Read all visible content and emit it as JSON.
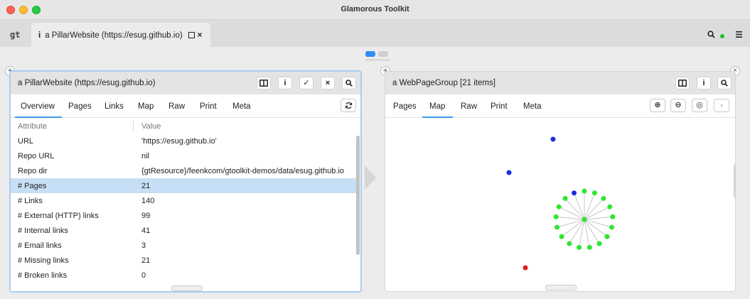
{
  "window": {
    "title": "Glamorous Toolkit"
  },
  "tabstrip": {
    "home_label": "gt",
    "tab_icon": "i",
    "tab_label": "a PillarWebsite (https://esug.github.io)",
    "close": "×",
    "search_icon": "search-icon",
    "menu_icon": "menu-icon"
  },
  "left_pane": {
    "title": "a PillarWebsite (https://esug.github.io)",
    "header_buttons": [
      "book-icon",
      "info-icon",
      "check-icon",
      "close-icon",
      "search-icon"
    ],
    "tabs": [
      "Overview",
      "Pages",
      "Links",
      "Map",
      "Raw",
      "Print",
      "Meta"
    ],
    "active_tab": "Overview",
    "columns": [
      "Attribute",
      "Value"
    ],
    "rows": [
      {
        "attribute": "URL",
        "value": "'https://esug.github.io'"
      },
      {
        "attribute": "Repo URL",
        "value": "nil"
      },
      {
        "attribute": "Repo dir",
        "value": "{gtResource}/feenkcom/gtoolkit-demos/data/esug.github.io"
      },
      {
        "attribute": "# Pages",
        "value": "21"
      },
      {
        "attribute": "# Links",
        "value": "140"
      },
      {
        "attribute": "# External (HTTP) links",
        "value": "99"
      },
      {
        "attribute": "# Internal links",
        "value": "41"
      },
      {
        "attribute": "# Email links",
        "value": "3"
      },
      {
        "attribute": "# Missing links",
        "value": "21"
      },
      {
        "attribute": "# Broken links",
        "value": "0"
      }
    ],
    "selected_row": "# Pages"
  },
  "right_pane": {
    "title": "a WebPageGroup [21 items]",
    "header_buttons": [
      "book-icon",
      "info-icon",
      "search-icon"
    ],
    "tabs": [
      "Pages",
      "Map",
      "Raw",
      "Print",
      "Meta"
    ],
    "active_tab": "Map",
    "map_buttons": [
      "zoom-in-icon",
      "zoom-out-icon",
      "zoom-reset-icon",
      "fit-icon"
    ],
    "colors": {
      "green": "#2ee62e",
      "blue": "#1a2be0",
      "red": "#e01a1a",
      "edge": "#bbbbbb"
    }
  }
}
